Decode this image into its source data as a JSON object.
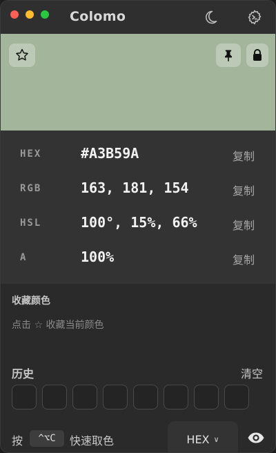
{
  "app": {
    "title": "Colomo"
  },
  "swatch": {
    "color": "#A3B59A"
  },
  "values": {
    "hex": {
      "label": "HEX",
      "value": "#A3B59A",
      "copy": "复制"
    },
    "rgb": {
      "label": "RGB",
      "value": "163, 181, 154",
      "copy": "复制"
    },
    "hsl": {
      "label": "HSL",
      "value": "100°, 15%, 66%",
      "copy": "复制"
    },
    "alpha": {
      "label": "A",
      "value": "100%",
      "copy": "复制"
    }
  },
  "favorites": {
    "title": "收藏颜色",
    "hint": "点击 ☆ 收藏当前颜色"
  },
  "history": {
    "title": "历史",
    "clear_label": "清空",
    "slot_count": 8
  },
  "footer": {
    "shortcut_prefix": "按",
    "shortcut_key": "^⌥C",
    "shortcut_suffix": "快速取色",
    "format_selected": "HEX",
    "format_caret": "∨"
  },
  "icons": {
    "theme": "moon-icon",
    "settings": "gear-icon",
    "favorite": "star-icon",
    "pin": "pin-icon",
    "lock": "lock-icon",
    "preview": "eye-icon"
  }
}
